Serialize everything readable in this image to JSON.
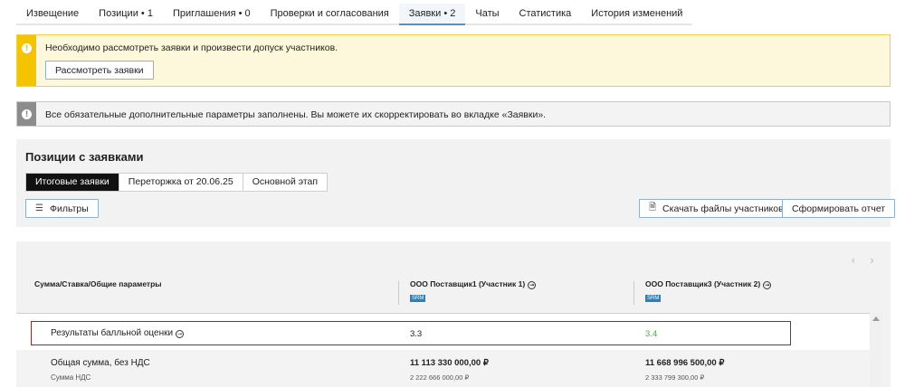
{
  "tabs": [
    {
      "label": "Извещение"
    },
    {
      "label": "Позиции • 1"
    },
    {
      "label": "Приглашения • 0"
    },
    {
      "label": "Проверки и согласования"
    },
    {
      "label": "Заявки • 2"
    },
    {
      "label": "Чаты"
    },
    {
      "label": "Статистика"
    },
    {
      "label": "История изменений"
    }
  ],
  "active_tab": "Заявки • 2",
  "alerts": {
    "warning_text": "Необходимо рассмотреть заявки и произвести допуск участников.",
    "warning_button": "Рассмотреть заявки",
    "info_text": "Все обязательные дополнительные параметры заполнены. Вы можете их скорректировать во вкладке «Заявки»."
  },
  "positions": {
    "title": "Позиции с заявками",
    "segments": [
      "Итоговые заявки",
      "Переторжка от 20.06.25",
      "Основной этап"
    ],
    "active_segment": "Итоговые заявки",
    "filters_label": "Фильтры",
    "download_label": "Скачать файлы участников",
    "report_label": "Сформировать отчет"
  },
  "table": {
    "param_header": "Сумма/Ставка/Общие параметры",
    "suppliers": [
      {
        "name": "ООО Поставщик1 (Участник 1)",
        "badge": "SRM"
      },
      {
        "name": "ООО Поставщик3 (Участник 2)",
        "badge": "SRM"
      }
    ],
    "rows": [
      {
        "label": "Результаты балльной оценки",
        "v1": "3.3",
        "v2": "3.4"
      },
      {
        "label": "Общая сумма, без НДС",
        "sublabel": "Сумма НДС",
        "v1": "11 113 330 000,00 ₽",
        "v1_sub": "2 222 666 000,00 ₽",
        "v2": "11 668 996 500,00 ₽",
        "v2_sub": "2 333 799 300,00 ₽"
      }
    ]
  },
  "icons": {
    "info": "exclamation-icon",
    "filter": "sliders-icon",
    "download": "file-download-icon",
    "prev": "chevron-left-icon",
    "next": "chevron-right-icon",
    "link": "arrow-circle-icon"
  },
  "colors": {
    "warning_stripe": "#f5c400",
    "warning_bg": "#fdf8dc",
    "info_stripe": "#8c8c8c",
    "highlight_border": "#8b2f23",
    "positive_value": "#4caf50",
    "badge": "#2f7fb8",
    "active_tab_underline": "#5a8fb8"
  }
}
